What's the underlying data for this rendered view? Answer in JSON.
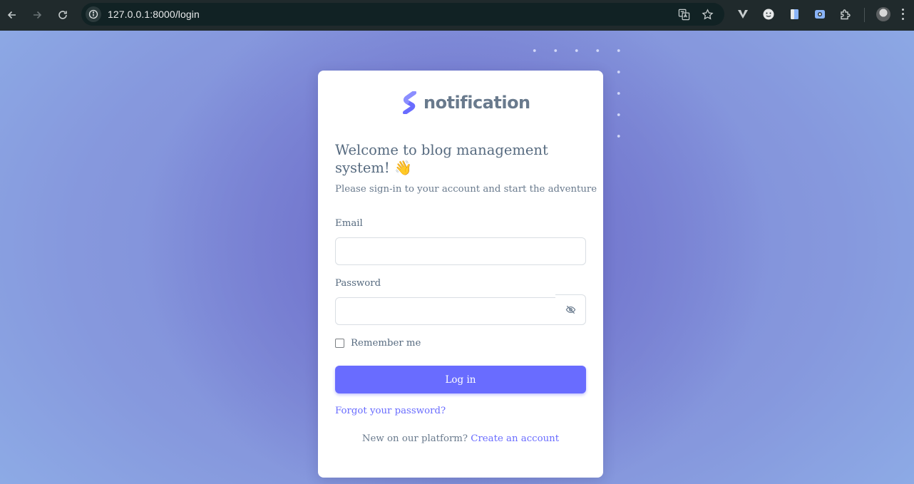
{
  "browser": {
    "url": "127.0.0.1:8000/login",
    "icons": [
      "back-icon",
      "forward-icon",
      "reload-icon",
      "site-info-icon",
      "translate-icon",
      "bookmark-star-icon",
      "vivaldi-extension-icon",
      "emoji-extension-icon",
      "docs-extension-icon",
      "screen-capture-extension-icon",
      "extensions-puzzle-icon",
      "profile-avatar",
      "menu-icon"
    ]
  },
  "brand": {
    "name": "notification",
    "logo_color": "#696cff"
  },
  "welcome": {
    "title": "Welcome to blog management system!",
    "emoji": "👋",
    "subtitle": "Please sign-in to your account and start the adventure"
  },
  "form": {
    "email_label": "Email",
    "email_value": "",
    "password_label": "Password",
    "password_value": "",
    "toggle_icon": "eye-off-icon",
    "remember_label": "Remember me",
    "remember_checked": false,
    "login_label": "Log in",
    "forgot_label": "Forgot your password?",
    "signup_prompt": "New on our platform?",
    "signup_link": "Create an account"
  },
  "colors": {
    "accent": "#696cff",
    "text": "#566a7f",
    "muted": "#697a8d"
  }
}
